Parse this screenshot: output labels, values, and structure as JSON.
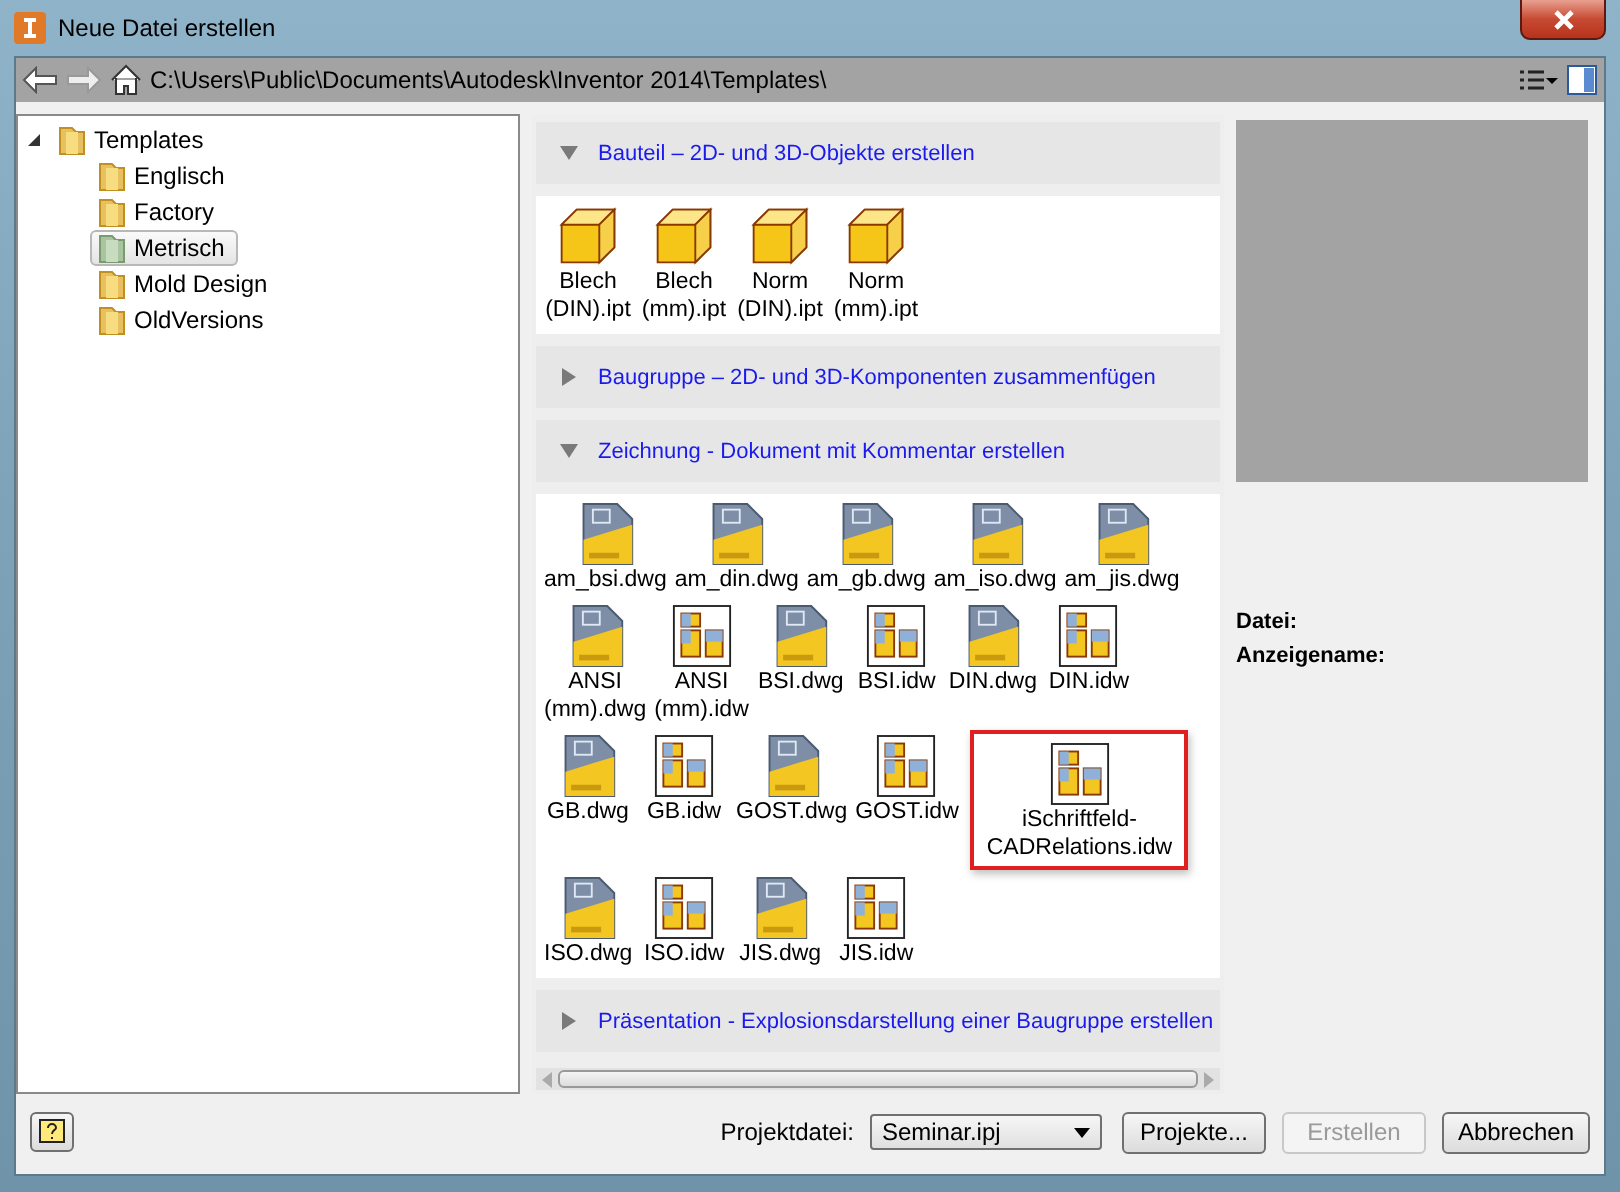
{
  "window": {
    "title": "Neue Datei erstellen"
  },
  "address_bar": {
    "path": "C:\\Users\\Public\\Documents\\Autodesk\\Inventor 2014\\Templates\\"
  },
  "tree": [
    {
      "label": "Templates",
      "expanded": true,
      "selected": false,
      "children": [
        {
          "label": "Englisch",
          "selected": false
        },
        {
          "label": "Factory",
          "selected": false
        },
        {
          "label": "Metrisch",
          "selected": true
        },
        {
          "label": "Mold Design",
          "selected": false
        },
        {
          "label": "OldVersions",
          "selected": false
        }
      ]
    }
  ],
  "sections": [
    {
      "title": "Bauteil – 2D- und 3D-Objekte erstellen",
      "expanded": true,
      "files": [
        {
          "label": "Blech (DIN).ipt",
          "kind": "part",
          "highlighted": false
        },
        {
          "label": "Blech (mm).ipt",
          "kind": "part",
          "highlighted": false
        },
        {
          "label": "Norm (DIN).ipt",
          "kind": "part",
          "highlighted": false
        },
        {
          "label": "Norm (mm).ipt",
          "kind": "part",
          "highlighted": false
        }
      ]
    },
    {
      "title": "Baugruppe – 2D- und 3D-Komponenten zusammenfügen",
      "expanded": false
    },
    {
      "title": "Zeichnung - Dokument mit Kommentar erstellen",
      "expanded": true,
      "files": [
        {
          "label": "am_bsi.dwg",
          "kind": "dwg",
          "highlighted": false
        },
        {
          "label": "am_din.dwg",
          "kind": "dwg",
          "highlighted": false
        },
        {
          "label": "am_gb.dwg",
          "kind": "dwg",
          "highlighted": false
        },
        {
          "label": "am_iso.dwg",
          "kind": "dwg",
          "highlighted": false
        },
        {
          "label": "am_jis.dwg",
          "kind": "dwg",
          "highlighted": false
        },
        {
          "label": "ANSI (mm).dwg",
          "kind": "dwg",
          "highlighted": false
        },
        {
          "label": "ANSI (mm).idw",
          "kind": "idw",
          "highlighted": false
        },
        {
          "label": "BSI.dwg",
          "kind": "dwg",
          "highlighted": false
        },
        {
          "label": "BSI.idw",
          "kind": "idw",
          "highlighted": false
        },
        {
          "label": "DIN.dwg",
          "kind": "dwg",
          "highlighted": false
        },
        {
          "label": "DIN.idw",
          "kind": "idw",
          "highlighted": false
        },
        {
          "label": "GB.dwg",
          "kind": "dwg",
          "highlighted": false
        },
        {
          "label": "GB.idw",
          "kind": "idw",
          "highlighted": false
        },
        {
          "label": "GOST.dwg",
          "kind": "dwg",
          "highlighted": false
        },
        {
          "label": "GOST.idw",
          "kind": "idw",
          "highlighted": false
        },
        {
          "label": "iSchriftfeld-CADRelations.idw",
          "kind": "idw",
          "highlighted": true
        },
        {
          "label": "ISO.dwg",
          "kind": "dwg",
          "highlighted": false
        },
        {
          "label": "ISO.idw",
          "kind": "idw",
          "highlighted": false
        },
        {
          "label": "JIS.dwg",
          "kind": "dwg",
          "highlighted": false
        },
        {
          "label": "JIS.idw",
          "kind": "idw",
          "highlighted": false
        }
      ]
    },
    {
      "title": "Präsentation - Explosionsdarstellung einer Baugruppe erstellen",
      "expanded": false
    }
  ],
  "details": {
    "file_label": "Datei:",
    "display_name_label": "Anzeigename:"
  },
  "footer": {
    "project_label": "Projektdatei:",
    "project_value": "Seminar.ipj",
    "buttons": [
      {
        "label": "Projekte...",
        "disabled": false
      },
      {
        "label": "Erstellen",
        "disabled": true
      },
      {
        "label": "Abbrechen",
        "disabled": false
      }
    ]
  }
}
